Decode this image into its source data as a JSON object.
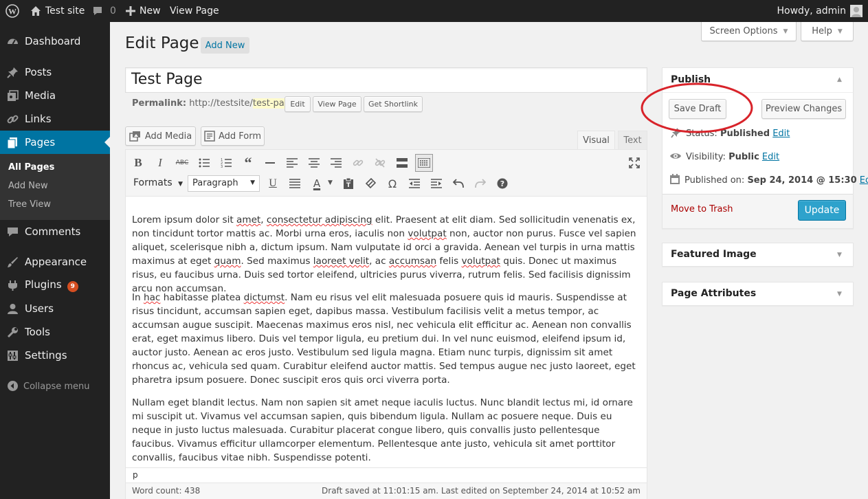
{
  "admin_bar": {
    "site_name": "Test site",
    "comments_count": "0",
    "new_label": "New",
    "view_page_label": "View Page",
    "howdy": "Howdy, admin"
  },
  "sidebar": {
    "items": [
      {
        "label": "Dashboard",
        "icon": "dashboard-icon"
      },
      {
        "label": "Posts",
        "icon": "pin-icon"
      },
      {
        "label": "Media",
        "icon": "media-icon"
      },
      {
        "label": "Links",
        "icon": "link-icon"
      },
      {
        "label": "Pages",
        "icon": "pages-icon"
      },
      {
        "label": "Comments",
        "icon": "comment-icon"
      },
      {
        "label": "Appearance",
        "icon": "brush-icon"
      },
      {
        "label": "Plugins",
        "icon": "plugin-icon",
        "badge": "9"
      },
      {
        "label": "Users",
        "icon": "users-icon"
      },
      {
        "label": "Tools",
        "icon": "wrench-icon"
      },
      {
        "label": "Settings",
        "icon": "settings-icon"
      }
    ],
    "pages_submenu": [
      "All Pages",
      "Add New",
      "Tree View"
    ],
    "collapse_label": "Collapse menu"
  },
  "header": {
    "screen_options": "Screen Options",
    "help": "Help",
    "title": "Edit Page",
    "add_new": "Add New"
  },
  "editor": {
    "post_title": "Test Page",
    "permalink_label": "Permalink:",
    "permalink_base": "http://testsite/",
    "permalink_slug": "test-page",
    "permalink_trailing": "/",
    "edit_label": "Edit",
    "view_page_label": "View Page",
    "get_shortlink_label": "Get Shortlink",
    "add_media": "Add Media",
    "add_form": "Add Form",
    "tab_visual": "Visual",
    "tab_text": "Text",
    "formats_label": "Formats",
    "block_format": "Paragraph",
    "paragraphs": [
      {
        "a": "Lorem ipsum dolor sit ",
        "b": "amet",
        "c": ", ",
        "d": "consectetur adipiscing",
        "e": " elit. Praesent at elit diam. Sed sollicitudin venenatis ex, non tincidunt tortor mattis ac. Morbi urna eros, iaculis non ",
        "f": "volutpat",
        "g": " non, auctor non purus. Fusce vel sapien aliquet, scelerisque nibh a, dictum ipsum. Nam vulputate id orci a gravida. Aenean vel turpis in urna mattis maximus at eget ",
        "h": "quam",
        "i": ". Sed maximus ",
        "j": "laoreet velit",
        "k": ", ac ",
        "l": "accumsan",
        "m": " felis ",
        "n": "volutpat",
        "o": " quis. Donec ut maximus risus, eu faucibus urna. Duis sed tortor eleifend, ultricies purus viverra, rutrum felis. Sed facilisis dignissim arcu non accumsan."
      },
      {
        "a": "In ",
        "b": "hac",
        "c": " habitasse platea ",
        "d": "dictumst",
        "e": ". Nam eu risus vel elit malesuada posuere quis id mauris. Suspendisse at risus tincidunt, accumsan sapien eget, dapibus massa. Vestibulum facilisis velit a metus tempor, ac accumsan augue suscipit. Maecenas maximus eros nisl, nec vehicula elit efficitur ac. Aenean non convallis erat, eget maximus libero. Duis vel tempor ligula, eu pretium dui. In vel nunc euismod, eleifend ipsum id, auctor justo. Aenean ac eros justo. Vestibulum sed ligula magna. Etiam nunc turpis, dignissim sit amet rhoncus ac, vehicula sed quam. Curabitur eleifend auctor mattis. Sed tempus augue nec justo laoreet, eget pharetra ipsum posuere. Donec suscipit eros quis orci viverra porta."
      },
      {
        "a": "Nullam eget blandit lectus. Nam non sapien sit amet neque iaculis luctus. Nunc blandit lectus mi, id ornare mi suscipit ut. Vivamus vel accumsan sapien, quis bibendum ligula. Nullam ac posuere neque. Duis eu neque in justo luctus malesuada. Curabitur placerat congue libero, quis convallis justo pellentesque faucibus. Vivamus efficitur ullamcorper elementum. Pellentesque ante justo, vehicula sit amet porttitor convallis, faucibus vitae nibh. Suspendisse potenti."
      }
    ],
    "path": "p",
    "word_count": "Word count: 438",
    "draft_status": "Draft saved at 11:01:15 am. Last edited on September 24, 2014 at 10:52 am"
  },
  "publish": {
    "title": "Publish",
    "save_draft": "Save Draft",
    "preview_changes": "Preview Changes",
    "status_label": "Status: ",
    "status_value": "Published",
    "visibility_label": "Visibility: ",
    "visibility_value": "Public",
    "published_label": "Published on: ",
    "published_value": "Sep 24, 2014 @ 15:30",
    "edit_link": "Edit",
    "move_to_trash": "Move to Trash",
    "update": "Update"
  },
  "boxes": {
    "featured_image": "Featured Image",
    "page_attributes": "Page Attributes"
  },
  "colors": {
    "admin_bar": "#222222",
    "active_menu": "#0074a2",
    "update_button": "#2ea2cc",
    "annotation_circle": "#d8232a",
    "trash_link": "#a00000",
    "badge": "#d54e21"
  }
}
